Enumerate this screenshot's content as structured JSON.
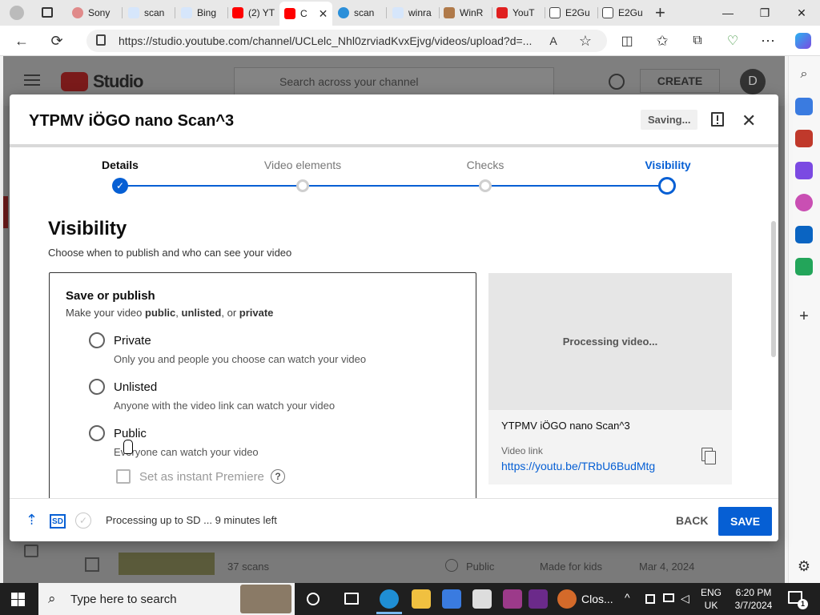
{
  "browser": {
    "tabs": [
      {
        "label": "Sony",
        "color": "#d9534f"
      },
      {
        "label": "scan",
        "color": "#2b7de9"
      },
      {
        "label": "Bing",
        "color": "#2b7de9"
      },
      {
        "label": "(2) YT",
        "color": "#ff0000"
      },
      {
        "label": "C",
        "color": "#ff0000"
      },
      {
        "label": "scan",
        "color": "#2b7de9"
      },
      {
        "label": "winra",
        "color": "#2b7de9"
      },
      {
        "label": "WinR",
        "color": "#8a5a2a"
      },
      {
        "label": "YouT",
        "color": "#e02020"
      },
      {
        "label": "E2Gu",
        "color": "#555555"
      },
      {
        "label": "E2Gu",
        "color": "#555555"
      }
    ],
    "url": "https://studio.youtube.com/channel/UCLelc_Nhl0zrviadKvxEjvg/videos/upload?d=...",
    "new_tab_symbol": "+"
  },
  "studio": {
    "logo_text": "Studio",
    "search_placeholder": "Search across your channel",
    "create_label": "CREATE",
    "avatar_letter": "D",
    "row": {
      "title": "37 scans",
      "visibility": "Public",
      "audience": "Made for kids",
      "date": "Mar 4, 2024"
    }
  },
  "dialog": {
    "title": "YTPMV iÖGO nano Scan^3",
    "status": "Saving...",
    "steps": [
      {
        "label": "Details",
        "state": "done"
      },
      {
        "label": "Video elements",
        "state": "pending"
      },
      {
        "label": "Checks",
        "state": "pending"
      },
      {
        "label": "Visibility",
        "state": "current"
      }
    ],
    "visibility_title": "Visibility",
    "visibility_subtitle": "Choose when to publish and who can see your video",
    "save_box": {
      "title": "Save or publish",
      "subtitle_prefix": "Make your video ",
      "subtitle_public": "public",
      "subtitle_sep1": ", ",
      "subtitle_unlisted": "unlisted",
      "subtitle_sep2": ", or ",
      "subtitle_private": "private",
      "options": [
        {
          "label": "Private",
          "desc": "Only you and people you choose can watch your video"
        },
        {
          "label": "Unlisted",
          "desc": "Anyone with the video link can watch your video"
        },
        {
          "label": "Public",
          "desc": "Everyone can watch your video"
        }
      ],
      "premiere_label": "Set as instant Premiere",
      "help_symbol": "?"
    },
    "preview": {
      "processing_text": "Processing video...",
      "video_title": "YTPMV iÖGO nano Scan^3",
      "link_label": "Video link",
      "link_url": "https://youtu.be/TRbU6BudMtg"
    },
    "footer": {
      "sd_badge": "SD",
      "processing_status": "Processing up to SD ... 9 minutes left",
      "back_label": "BACK",
      "save_label": "SAVE"
    }
  },
  "taskbar": {
    "search_placeholder": "Type here to search",
    "app_label": "Clos...",
    "lang_top": "ENG",
    "lang_bottom": "UK",
    "time": "6:20 PM",
    "date": "3/7/2024",
    "notification_count": "1"
  },
  "colors": {
    "accent": "#065fd4",
    "youtube_red": "#ff0000"
  }
}
